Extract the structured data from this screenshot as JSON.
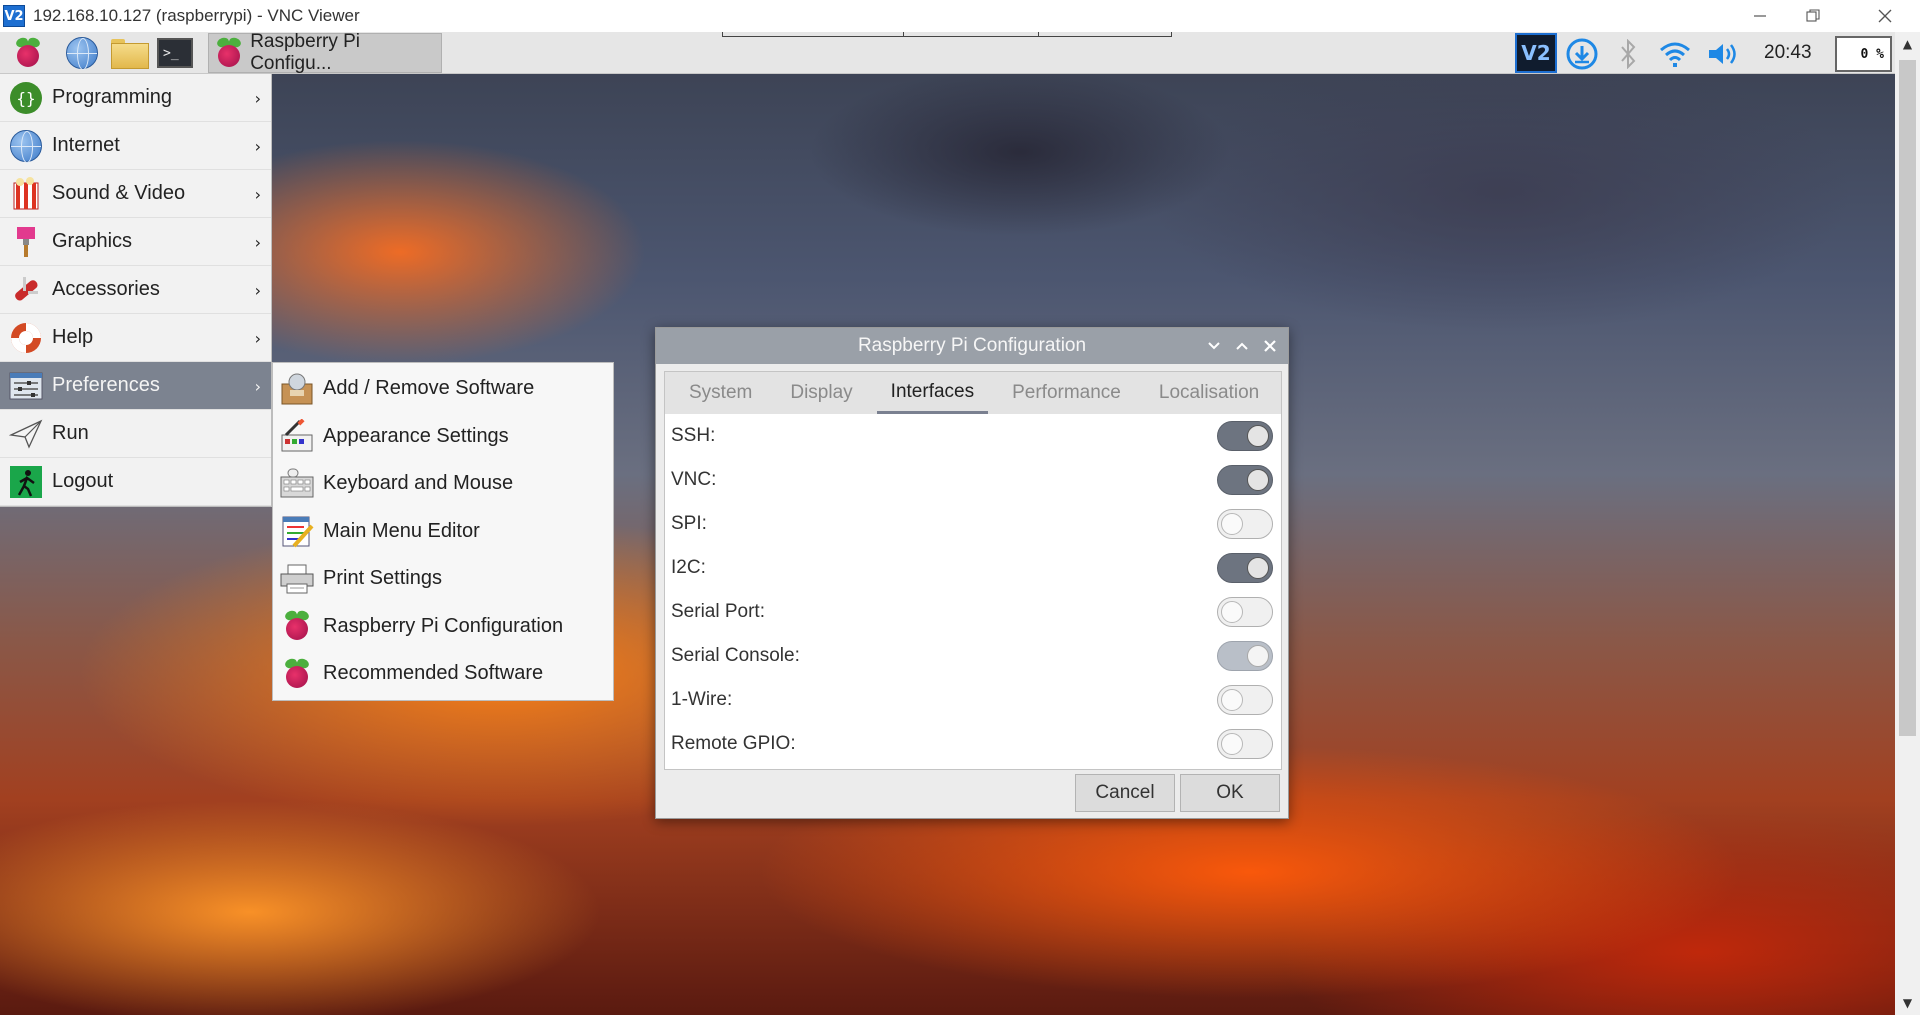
{
  "viewer": {
    "logo": "V2",
    "title": "192.168.10.127 (raspberrypi) - VNC Viewer",
    "controls": [
      "minimize-icon",
      "restore-icon",
      "close-icon"
    ]
  },
  "panel": {
    "launchers": [
      "raspberry-menu-icon",
      "web-browser-icon",
      "file-manager-icon",
      "terminal-icon"
    ],
    "taskbar_item": "Raspberry Pi Configu...",
    "terminal_glyph": ">_",
    "tray": {
      "vnc_label": "V2",
      "clock": "20:43",
      "cpu": "0 %"
    }
  },
  "menu": {
    "items": [
      {
        "label": "Programming",
        "icon": "programming-icon",
        "has_submenu": true
      },
      {
        "label": "Internet",
        "icon": "internet-icon",
        "has_submenu": true
      },
      {
        "label": "Sound & Video",
        "icon": "sound-video-icon",
        "has_submenu": true
      },
      {
        "label": "Graphics",
        "icon": "graphics-icon",
        "has_submenu": true
      },
      {
        "label": "Accessories",
        "icon": "accessories-icon",
        "has_submenu": true
      },
      {
        "label": "Help",
        "icon": "help-icon",
        "has_submenu": true
      },
      {
        "label": "Preferences",
        "icon": "preferences-icon",
        "has_submenu": true,
        "active": true
      },
      {
        "label": "Run",
        "icon": "run-icon",
        "has_submenu": false
      },
      {
        "label": "Logout",
        "icon": "logout-icon",
        "has_submenu": false
      }
    ],
    "arrow": "›"
  },
  "submenu": {
    "items": [
      {
        "label": "Add / Remove Software",
        "icon": "package-icon"
      },
      {
        "label": "Appearance Settings",
        "icon": "appearance-icon"
      },
      {
        "label": "Keyboard and Mouse",
        "icon": "keyboard-icon"
      },
      {
        "label": "Main Menu Editor",
        "icon": "menu-editor-icon"
      },
      {
        "label": "Print Settings",
        "icon": "printer-icon"
      },
      {
        "label": "Raspberry Pi Configuration",
        "icon": "raspberry-icon"
      },
      {
        "label": "Recommended Software",
        "icon": "raspberry-icon"
      }
    ]
  },
  "dialog": {
    "title": "Raspberry Pi Configuration",
    "tabs": [
      "System",
      "Display",
      "Interfaces",
      "Performance",
      "Localisation"
    ],
    "active_tab": "Interfaces",
    "interfaces": [
      {
        "label": "SSH:",
        "state": "on"
      },
      {
        "label": "VNC:",
        "state": "on"
      },
      {
        "label": "SPI:",
        "state": "off"
      },
      {
        "label": "I2C:",
        "state": "on"
      },
      {
        "label": "Serial Port:",
        "state": "off"
      },
      {
        "label": "Serial Console:",
        "state": "on-disabled"
      },
      {
        "label": "1-Wire:",
        "state": "off"
      },
      {
        "label": "Remote GPIO:",
        "state": "off"
      }
    ],
    "cancel_label": "Cancel",
    "ok_label": "OK"
  },
  "colors": {
    "panel_bg": "#e6e6e6",
    "menu_active": "#7c8390",
    "dialog_title": "#9aa0a8",
    "toggle_on": "#6d7480",
    "vnc_blue": "#1e6fd1"
  }
}
